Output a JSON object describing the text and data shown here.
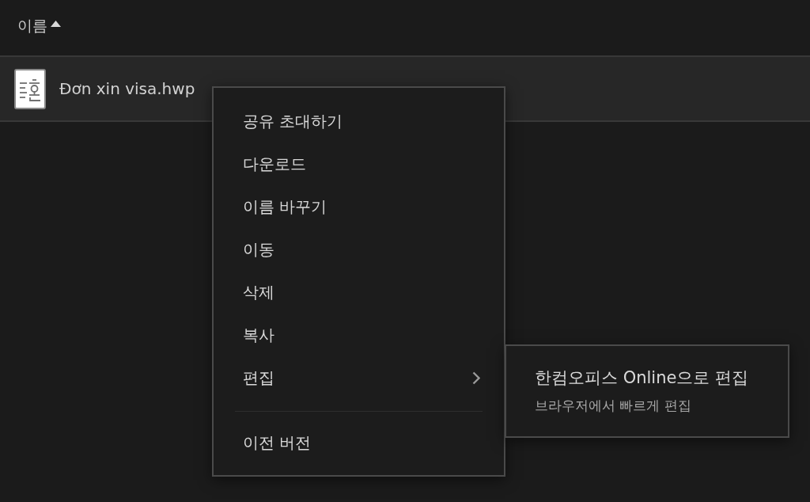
{
  "table": {
    "columns": [
      {
        "label": "이름",
        "sort_ascending": true
      }
    ],
    "rows": [
      {
        "name": "Đơn xin visa.hwp",
        "selected": true
      }
    ]
  },
  "context_menu": {
    "items": [
      {
        "kind": "item",
        "label": "공유 초대하기"
      },
      {
        "kind": "item",
        "label": "다운로드"
      },
      {
        "kind": "item",
        "label": "이름 바꾸기"
      },
      {
        "kind": "item",
        "label": "이동"
      },
      {
        "kind": "item",
        "label": "삭제"
      },
      {
        "kind": "item",
        "label": "복사"
      },
      {
        "kind": "submenu",
        "label": "편집",
        "expanded": true,
        "submenu": {
          "items": [
            {
              "title": "한컴오피스 Online으로 편집",
              "description": "브라우저에서 빠르게 편집"
            }
          ]
        }
      },
      {
        "kind": "separator"
      },
      {
        "kind": "item",
        "label": "이전 버전"
      }
    ]
  }
}
